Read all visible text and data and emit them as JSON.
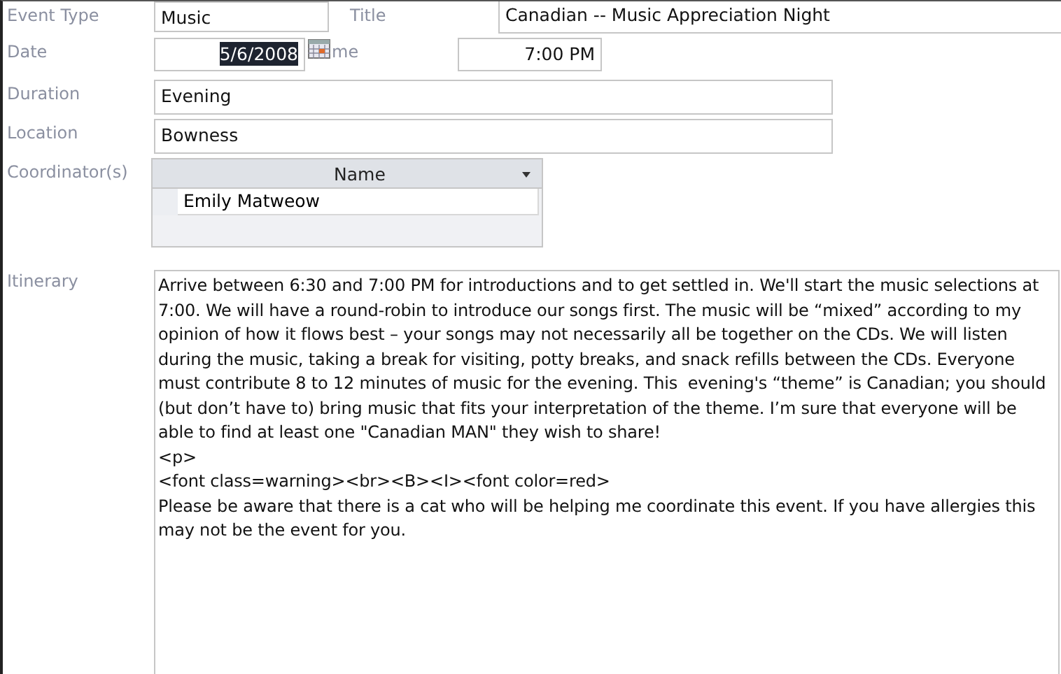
{
  "fields": {
    "event_type": {
      "label": "Event Type",
      "value": "Music"
    },
    "title": {
      "label": "Title",
      "value": "Canadian -- Music Appreciation Night"
    },
    "date": {
      "label": "Date",
      "value": "5/6/2008",
      "selected": true
    },
    "time": {
      "label": "me",
      "value": "7:00 PM"
    },
    "duration": {
      "label": "Duration",
      "value": "Evening"
    },
    "location": {
      "label": "Location",
      "value": "Bowness"
    }
  },
  "coordinators": {
    "label": "Coordinator(s)",
    "columns": [
      "Name"
    ],
    "rows": [
      "Emily Matweow"
    ]
  },
  "itinerary": {
    "label": "Itinerary",
    "lines": [
      "Arrive between 6:30 and 7:00 PM for introductions and to get settled in. We'll start the music selections at 7:00. We will have a round-robin to introduce our songs first. The music will be “mixed” according to my opinion of how it flows best – your songs may not necessarily all be together on the CDs. We will listen during the music, taking a break for visiting, potty breaks, and snack refills between the CDs. Everyone must contribute 8 to 12 minutes of music for the evening. This  evening's “theme” is Canadian; you should (but don’t have to) bring music that fits your interpretation of the theme. I’m sure that everyone will be able to find at least one \"Canadian MAN\" they wish to share!",
      "<p>",
      "<font class=warning><br><B><I><font color=red>",
      "Please be aware that there is a cat who will be helping me coordinate this event. If you have allergies this may not be the event for you."
    ]
  }
}
